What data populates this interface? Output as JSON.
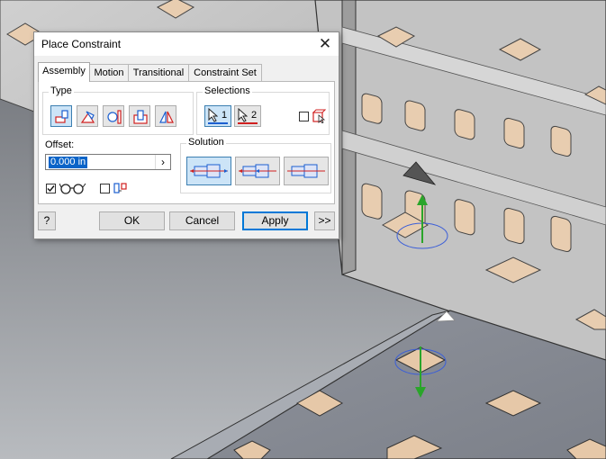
{
  "dialog": {
    "title": "Place Constraint",
    "tabs": [
      "Assembly",
      "Motion",
      "Transitional",
      "Constraint Set"
    ],
    "active_tab": "Assembly",
    "type_group_label": "Type",
    "type_buttons": [
      "mate-icon",
      "angle-icon",
      "tangent-icon",
      "insert-icon",
      "symmetry-icon"
    ],
    "selections_group_label": "Selections",
    "selection_1_label": "1",
    "selection_2_label": "2",
    "offset_label": "Offset:",
    "offset_value": "0.000 in",
    "solution_group_label": "Solution",
    "solution_buttons": [
      "opposed-solution-icon",
      "aligned-solution-icon",
      "undirected-solution-icon"
    ],
    "preview_checked": true,
    "predict_offset_checked": false,
    "first_occurrence_checked": false,
    "buttons": {
      "help": "?",
      "ok": "OK",
      "cancel": "Cancel",
      "apply": "Apply",
      "expand": ">>"
    }
  },
  "colors": {
    "selected_button": "#cce4f7",
    "accent": "#0078d7",
    "model_surface": "#c9c9c9",
    "hole_trim": "#d9b38c",
    "axis_green": "#2aa52a",
    "circle_blue": "#3b5ed8"
  }
}
